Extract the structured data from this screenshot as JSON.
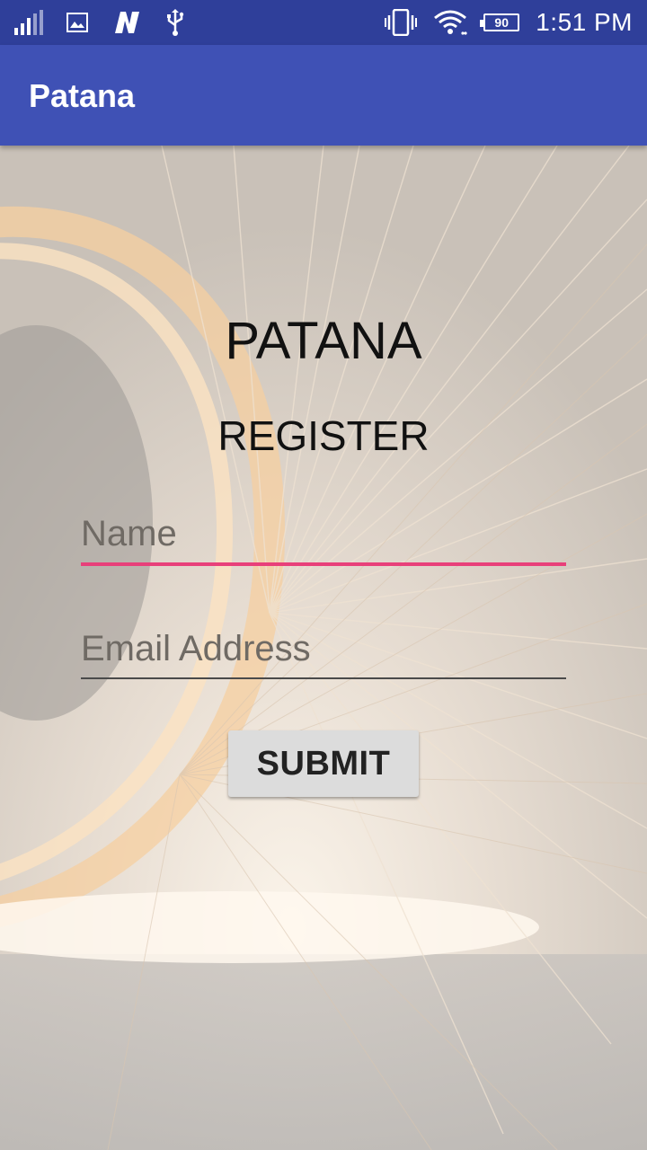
{
  "status_bar": {
    "time": "1:51 PM",
    "battery_level": "90",
    "left_icons": [
      "signal-icon",
      "image-notification-icon",
      "app-n-notification-icon",
      "usb-icon"
    ],
    "right_icons": [
      "vibrate-icon",
      "wifi-icon",
      "battery-icon"
    ]
  },
  "app_bar": {
    "title": "Patana",
    "color": "#3f51b5"
  },
  "main": {
    "brand_title": "PATANA",
    "heading": "REGISTER",
    "name_field": {
      "placeholder": "Name",
      "value": ""
    },
    "email_field": {
      "placeholder": "Email Address",
      "value": ""
    },
    "submit_label": "SUBMIT",
    "accent_color": "#e8407a"
  }
}
